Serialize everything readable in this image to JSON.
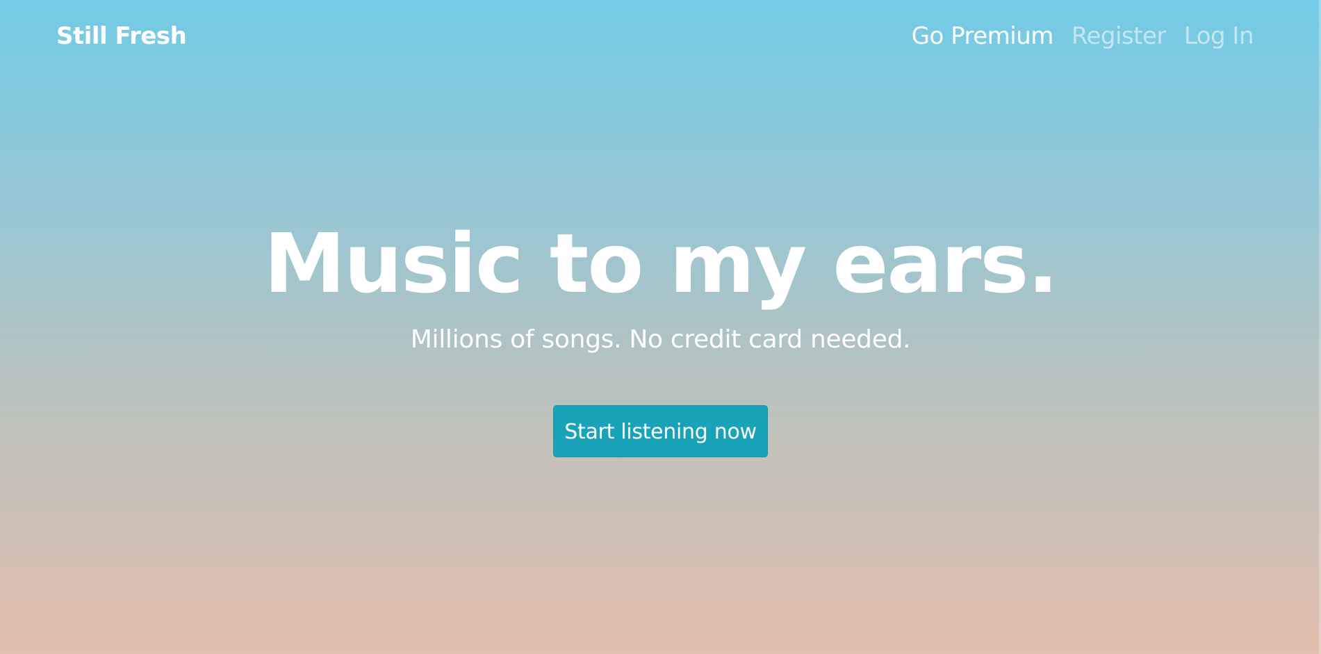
{
  "nav": {
    "brand": "Still Fresh",
    "links": [
      {
        "label": "Go Premium"
      },
      {
        "label": "Register"
      },
      {
        "label": "Log In"
      }
    ]
  },
  "hero": {
    "headline": "Music to my ears.",
    "subline": "Millions of songs. No credit card needed.",
    "cta_label": "Start listening now"
  },
  "colors": {
    "gradient_top": "#73cbe6",
    "gradient_bottom": "#e2bfae",
    "cta_background": "#19a3b8"
  }
}
